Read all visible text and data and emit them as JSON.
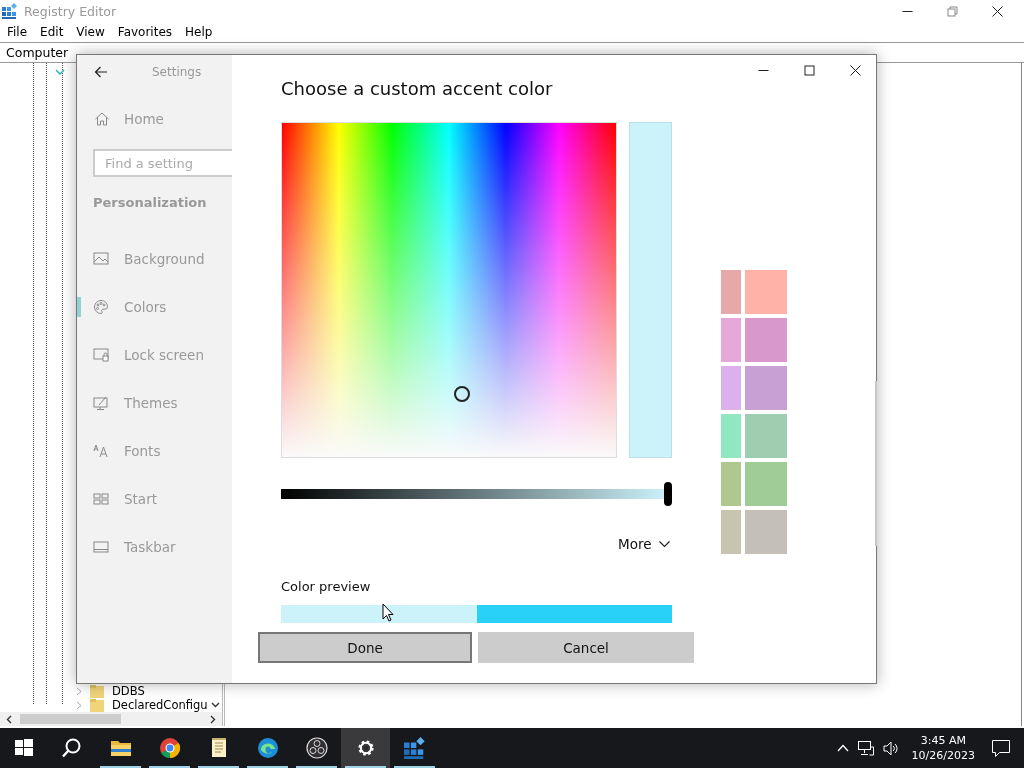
{
  "registry_editor": {
    "title": "Registry Editor",
    "menu": [
      "File",
      "Edit",
      "View",
      "Favorites",
      "Help"
    ],
    "address": "Computer",
    "tree_items": [
      {
        "label": "DDBS"
      },
      {
        "label": "DeclaredConfigu"
      }
    ]
  },
  "settings": {
    "title": "Settings",
    "home": "Home",
    "search": {
      "placeholder": "Find a setting"
    },
    "section": "Personalization",
    "nav": [
      {
        "label": "Background",
        "kind": "background",
        "selected": false
      },
      {
        "label": "Colors",
        "kind": "colors",
        "selected": true
      },
      {
        "label": "Lock screen",
        "kind": "lock",
        "selected": false
      },
      {
        "label": "Themes",
        "kind": "themes",
        "selected": false
      },
      {
        "label": "Fonts",
        "kind": "fonts",
        "selected": false
      },
      {
        "label": "Start",
        "kind": "start",
        "selected": false
      },
      {
        "label": "Taskbar",
        "kind": "taskbar",
        "selected": false
      }
    ],
    "swatches": [
      {
        "color": "#e6a8a8"
      },
      {
        "color": "#ffb3a8"
      },
      {
        "color": "#e6a8d8"
      },
      {
        "color": "#d898cc"
      },
      {
        "color": "#dcb0ec"
      },
      {
        "color": "#c8a0d4"
      },
      {
        "color": "#90e8c0"
      },
      {
        "color": "#a0ccb0"
      },
      {
        "color": "#b0c890"
      },
      {
        "color": "#a0cc98"
      },
      {
        "color": "#c8c4b0"
      },
      {
        "color": "#c4c0b8"
      }
    ]
  },
  "dialog": {
    "title": "Choose a custom accent color",
    "brightness": {
      "level": 1
    },
    "more": "More",
    "preview_label": "Color preview",
    "preview": [
      {
        "color": "#ccf2fa"
      },
      {
        "color": "#29d0f8"
      }
    ],
    "buttons": [
      {
        "label": "Done",
        "selected": true
      },
      {
        "label": "Cancel",
        "selected": false
      }
    ]
  },
  "taskbar": {
    "apps": [
      {
        "kind": "start",
        "running": false,
        "selected": false
      },
      {
        "kind": "search",
        "running": false,
        "selected": false
      },
      {
        "kind": "folder",
        "running": true,
        "selected": false
      },
      {
        "kind": "chrome",
        "running": true,
        "selected": false
      },
      {
        "kind": "notepad",
        "running": true,
        "selected": false
      },
      {
        "kind": "edge",
        "running": true,
        "selected": false
      },
      {
        "kind": "obs",
        "running": true,
        "selected": false
      },
      {
        "kind": "settings",
        "running": true,
        "selected": true
      },
      {
        "kind": "regedit",
        "running": true,
        "selected": false
      }
    ],
    "clock": {
      "time": "3:45 AM",
      "date": "10/26/2023"
    }
  }
}
